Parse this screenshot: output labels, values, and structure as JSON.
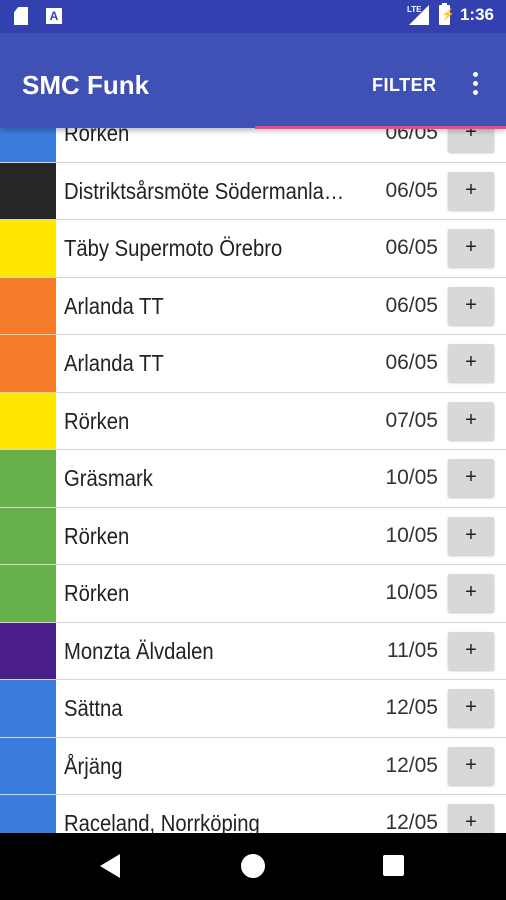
{
  "status_bar": {
    "time": "1:36",
    "network": "LTE",
    "icons": [
      "sd-card-icon",
      "app-notification-icon",
      "lte-signal-icon",
      "battery-charging-icon"
    ]
  },
  "app_bar": {
    "title": "SMC Funk",
    "filter_label": "FILTER",
    "overflow_icon": "more-vert-icon"
  },
  "events": [
    {
      "name": "Rörken",
      "date": "06/05",
      "color": "#3b7ddd"
    },
    {
      "name": "Distriktsårsmöte Södermanla…",
      "date": "06/05",
      "color": "#262626"
    },
    {
      "name": "Täby Supermoto Örebro",
      "date": "06/05",
      "color": "#ffe600"
    },
    {
      "name": "Arlanda TT",
      "date": "06/05",
      "color": "#f57c2b"
    },
    {
      "name": "Arlanda TT",
      "date": "06/05",
      "color": "#f57c2b"
    },
    {
      "name": "Rörken",
      "date": "07/05",
      "color": "#ffe600"
    },
    {
      "name": "Gräsmark",
      "date": "10/05",
      "color": "#66b04a"
    },
    {
      "name": "Rörken",
      "date": "10/05",
      "color": "#66b04a"
    },
    {
      "name": "Rörken",
      "date": "10/05",
      "color": "#66b04a"
    },
    {
      "name": "Monzta Älvdalen",
      "date": "11/05",
      "color": "#4a1f8c"
    },
    {
      "name": "Sättna",
      "date": "12/05",
      "color": "#3b7ddd"
    },
    {
      "name": "Årjäng",
      "date": "12/05",
      "color": "#3b7ddd"
    },
    {
      "name": "Raceland, Norrköping",
      "date": "12/05",
      "color": "#3b7ddd"
    }
  ],
  "add_label": "+",
  "colors": {
    "status_bar": "#3341b0",
    "app_bar": "#3f51b5",
    "tab_indicator": "#ec4a8b"
  }
}
